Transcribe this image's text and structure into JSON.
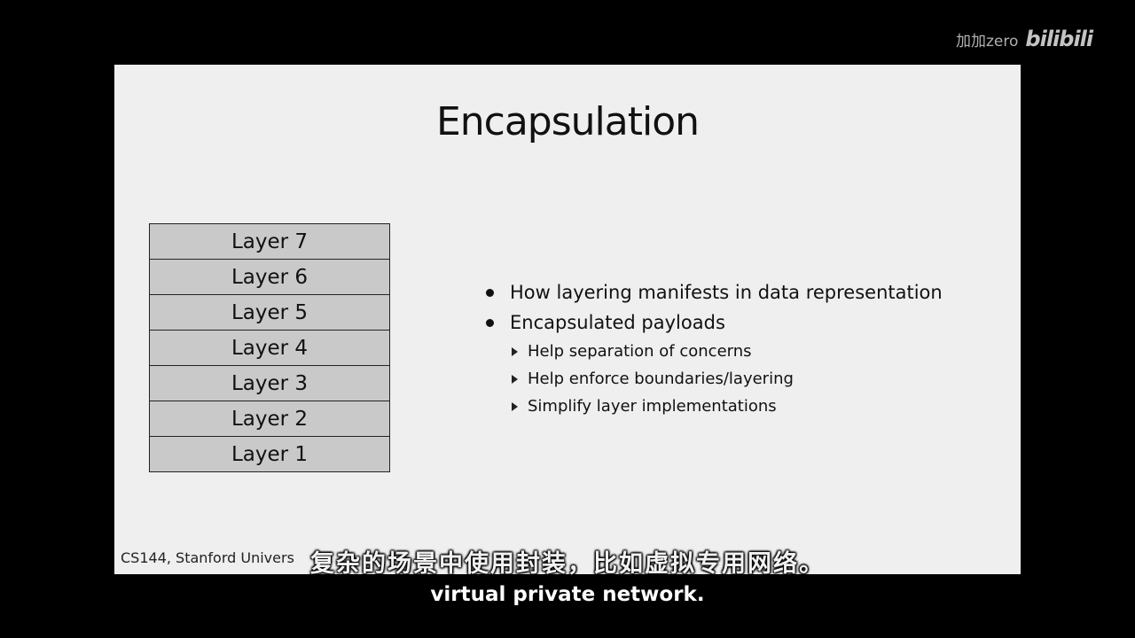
{
  "watermark": {
    "user": "加加zero",
    "logo": "bilibili"
  },
  "slide": {
    "title": "Encapsulation",
    "layers": [
      "Layer 7",
      "Layer 6",
      "Layer 5",
      "Layer 4",
      "Layer 3",
      "Layer 2",
      "Layer 1"
    ],
    "bullets": [
      {
        "text": "How layering manifests in data representation",
        "subs": []
      },
      {
        "text": "Encapsulated payloads",
        "subs": [
          "Help separation of concerns",
          "Help enforce boundaries/layering",
          "Simplify layer implementations"
        ]
      }
    ],
    "footer": "CS144, Stanford Univers"
  },
  "subtitles": {
    "chinese": "复杂的场景中使用封装，比如虚拟专用网络。",
    "english": "virtual private network."
  }
}
